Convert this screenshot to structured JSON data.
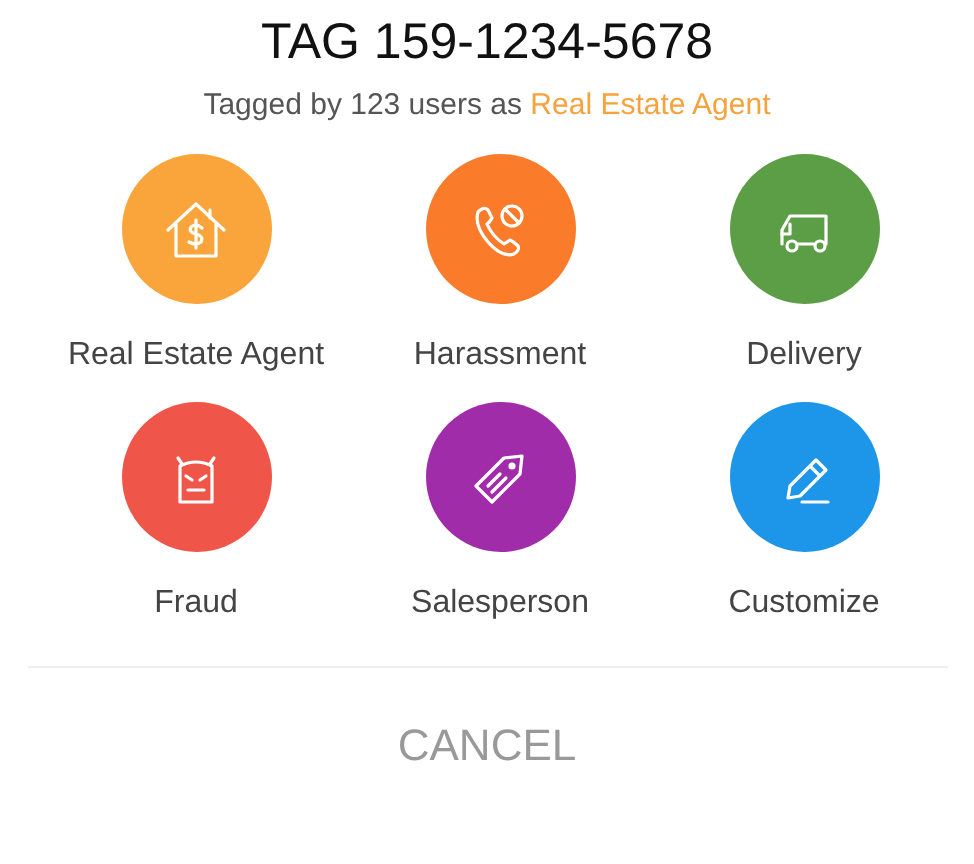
{
  "title": "TAG 159-1234-5678",
  "subtitle": {
    "text": "Tagged by 123 users as",
    "tag": "Real Estate Agent"
  },
  "tags": [
    {
      "label": "Real Estate Agent",
      "kind": "house",
      "color": "#faa53b"
    },
    {
      "label": "Harassment",
      "kind": "phone",
      "color": "#fa7c2b"
    },
    {
      "label": "Delivery",
      "kind": "truck",
      "color": "#5b9e46"
    },
    {
      "label": "Fraud",
      "kind": "devil",
      "color": "#ef5548"
    },
    {
      "label": "Salesperson",
      "kind": "sale",
      "color": "#a12ca9"
    },
    {
      "label": "Customize",
      "kind": "pencil",
      "color": "#1d95e8"
    }
  ],
  "cancel": "CANCEL"
}
